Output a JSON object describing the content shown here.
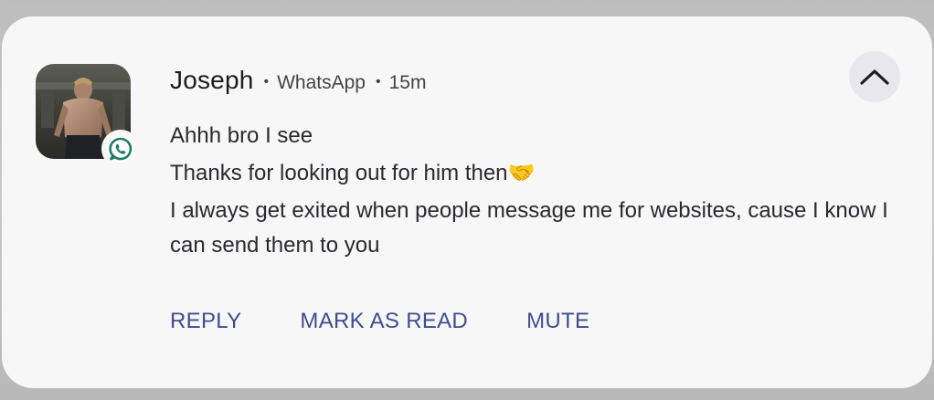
{
  "notification": {
    "sender": "Joseph",
    "app_name": "WhatsApp",
    "time": "15m",
    "separator": "•",
    "collapse_icon": "chevron-up-icon",
    "app_badge_icon": "whatsapp-icon",
    "messages": [
      "Ahhh bro I see",
      "Thanks for looking out for him then🤝",
      "I always get exited when people message me for websites, cause I know I can send them to you"
    ],
    "actions": {
      "reply": "REPLY",
      "mark_as_read": "MARK AS READ",
      "mute": "MUTE"
    },
    "colors": {
      "action_text": "#3f4e8e",
      "card_background": "#f7f7f8",
      "whatsapp_badge": "#1e7b64"
    }
  }
}
